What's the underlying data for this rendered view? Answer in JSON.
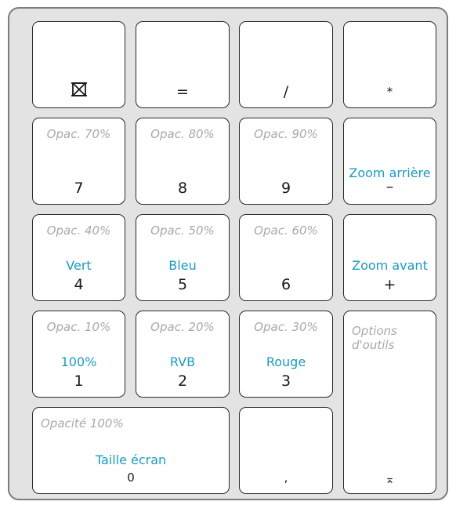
{
  "keys": {
    "clear": {
      "main": ""
    },
    "equals": {
      "main": "="
    },
    "divide": {
      "main": "/"
    },
    "multiply": {
      "main": "*"
    },
    "k7": {
      "hint": "Opac. 70%",
      "main": "7"
    },
    "k8": {
      "hint": "Opac. 80%",
      "main": "8"
    },
    "k9": {
      "hint": "Opac. 90%",
      "main": "9"
    },
    "minus": {
      "action": "Zoom arrière",
      "main": "–"
    },
    "k4": {
      "hint": "Opac. 40%",
      "action": "Vert",
      "main": "4"
    },
    "k5": {
      "hint": "Opac. 50%",
      "action": "Bleu",
      "main": "5"
    },
    "k6": {
      "hint": "Opac. 60%",
      "main": "6"
    },
    "plus": {
      "action": "Zoom avant",
      "main": "+"
    },
    "k1": {
      "hint": "Opac. 10%",
      "action": "100%",
      "main": "1"
    },
    "k2": {
      "hint": "Opac. 20%",
      "action": "RVB",
      "main": "2"
    },
    "k3": {
      "hint": "Opac. 30%",
      "action": "Rouge",
      "main": "3"
    },
    "enter": {
      "hint": "Options\nd'outils",
      "main": "⌅"
    },
    "k0": {
      "hint": "Opacité 100%",
      "action": "Taille écran",
      "main": "0"
    },
    "decimal": {
      "main": ","
    }
  },
  "colors": {
    "accent": "#1a9bc1",
    "hint": "#a9a9a9",
    "pad": "#e3e3e3"
  },
  "icons": {
    "clear": "clear-icon",
    "enter": "enter-icon"
  }
}
